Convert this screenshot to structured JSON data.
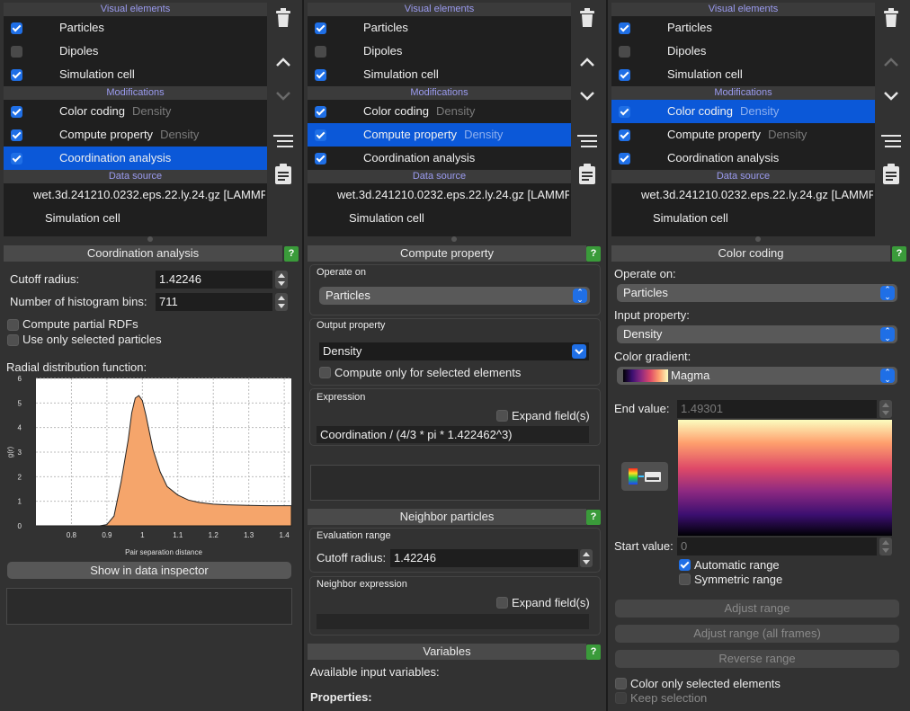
{
  "colors": {
    "accent": "#0b58d8",
    "checkbox": "#1f6fe6",
    "help": "#3a9b3a",
    "plot_fill": "#f5a56b"
  },
  "pipeline": {
    "visual_header": "Visual elements",
    "modifications_header": "Modifications",
    "datasource_header": "Data source",
    "visual_items": [
      {
        "label": "Particles",
        "checked": true
      },
      {
        "label": "Dipoles",
        "checked": false
      },
      {
        "label": "Simulation cell",
        "checked": true
      }
    ],
    "modifiers": [
      {
        "label": "Color coding",
        "sub": "Density",
        "checked": true
      },
      {
        "label": "Compute property",
        "sub": "Density",
        "checked": true
      },
      {
        "label": "Coordination analysis",
        "sub": "",
        "checked": true
      }
    ],
    "datasource_file": "wet.3d.241210.0232.eps.22.ly.24.gz [LAMMPS",
    "datasource_cell": "Simulation cell"
  },
  "toolbar_icons": [
    "trash-icon",
    "move-up-icon",
    "move-down-icon",
    "list-icon",
    "clipboard-icon"
  ],
  "panel1": {
    "title": "Coordination analysis",
    "help": "?",
    "cutoff_label": "Cutoff radius:",
    "cutoff_value": "1.42246",
    "bins_label": "Number of histogram bins:",
    "bins_value": "711",
    "partial_rdfs": "Compute partial RDFs",
    "only_selected": "Use only selected particles",
    "rdf_label": "Radial distribution function:",
    "show_inspector": "Show in data inspector"
  },
  "chart_data": {
    "type": "area",
    "xlabel": "Pair separation distance",
    "ylabel": "g(r)",
    "xlim": [
      0.7,
      1.42
    ],
    "ylim": [
      0,
      6
    ],
    "xticks": [
      "0.8",
      "0.9",
      "1",
      "1.1",
      "1.2",
      "1.3",
      "1.4"
    ],
    "yticks": [
      "0",
      "1",
      "2",
      "3",
      "4",
      "5",
      "6"
    ],
    "x": [
      0.7,
      0.88,
      0.9,
      0.92,
      0.94,
      0.96,
      0.97,
      0.98,
      0.99,
      1.0,
      1.01,
      1.02,
      1.03,
      1.05,
      1.07,
      1.1,
      1.13,
      1.16,
      1.2,
      1.25,
      1.3,
      1.35,
      1.42
    ],
    "y": [
      0,
      0,
      0.05,
      0.4,
      1.8,
      3.5,
      4.6,
      5.2,
      5.3,
      5.1,
      4.5,
      3.8,
      3.1,
      2.2,
      1.6,
      1.25,
      1.05,
      0.95,
      0.88,
      0.85,
      0.83,
      0.82,
      0.82
    ]
  },
  "panel2": {
    "title": "Compute property",
    "help": "?",
    "operate_on_label": "Operate on",
    "operate_on_value": "Particles",
    "output_label": "Output property",
    "output_value": "Density",
    "compute_selected": "Compute only for selected elements",
    "expression_label": "Expression",
    "expand_fields": "Expand field(s)",
    "expression_value": "Coordination / (4/3 * pi * 1.422462^3)",
    "neighbor_title": "Neighbor particles",
    "eval_range_label": "Evaluation range",
    "cutoff_label": "Cutoff radius:",
    "cutoff_value": "1.42246",
    "neighbor_expr_label": "Neighbor expression",
    "variables_title": "Variables",
    "available_vars": "Available input variables:",
    "properties": "Properties:"
  },
  "panel3": {
    "title": "Color coding",
    "help": "?",
    "operate_on_label": "Operate on:",
    "operate_on_value": "Particles",
    "input_label": "Input property:",
    "input_value": "Density",
    "gradient_label": "Color gradient:",
    "gradient_value": "Magma",
    "end_label": "End value:",
    "end_value": "1.49301",
    "start_label": "Start value:",
    "start_value": "0",
    "auto_range": "Automatic range",
    "sym_range": "Symmetric range",
    "adjust_range": "Adjust range",
    "adjust_all": "Adjust range (all frames)",
    "reverse_range": "Reverse range",
    "color_selected": "Color only selected elements",
    "keep_selection": "Keep selection"
  }
}
